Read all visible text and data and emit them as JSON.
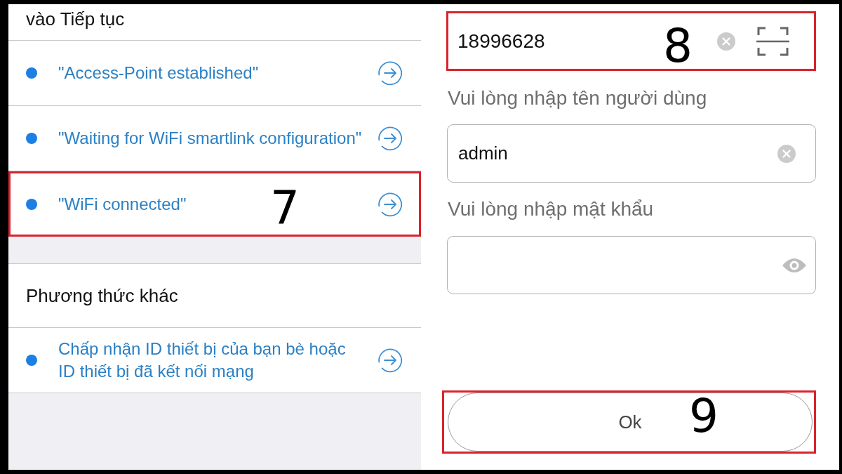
{
  "left_screen": {
    "instruction": "vào Tiếp tục",
    "status_items": [
      {
        "label": "\"Access-Point established\"",
        "highlighted": false
      },
      {
        "label": "\"Waiting for WiFi smartlink configuration\"",
        "highlighted": false
      },
      {
        "label": "\"WiFi connected\"",
        "highlighted": true,
        "callout": "7"
      }
    ],
    "other_methods": {
      "title": "Phương thức khác",
      "items": [
        {
          "label": "Chấp nhận ID thiết bị của bạn bè hoặc ID thiết bị đã kết nối mạng",
          "highlighted": false
        }
      ]
    }
  },
  "right_screen": {
    "device_id_field": {
      "value": "18996628",
      "highlighted": true,
      "callout": "8"
    },
    "username": {
      "label": "Vui lòng nhập tên người dùng",
      "value": "admin"
    },
    "password": {
      "label": "Vui lòng nhập mật khẩu"
    },
    "ok_button": {
      "label": "Ok",
      "highlighted": true,
      "callout": "9"
    }
  }
}
